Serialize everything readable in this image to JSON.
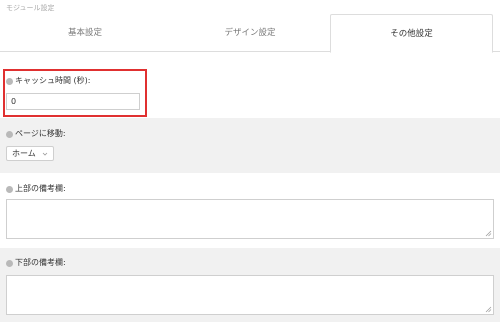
{
  "panel": {
    "title": "モジュール設定"
  },
  "tabs": [
    {
      "label": "基本設定",
      "active": false
    },
    {
      "label": "デザイン設定",
      "active": false
    },
    {
      "label": "その他設定",
      "active": true
    }
  ],
  "fields": {
    "cache": {
      "label": "キャッシュ時間 (秒):",
      "value": "0"
    },
    "move": {
      "label": "ページに移動:",
      "selected": "ホーム"
    },
    "top_note": {
      "label": "上部の備考欄:",
      "value": ""
    },
    "bottom_note": {
      "label": "下部の備考欄:",
      "value": ""
    }
  },
  "colors": {
    "highlight": "#e03030",
    "row_gray": "#f1f1f1",
    "dot": "#b9b9b9"
  }
}
